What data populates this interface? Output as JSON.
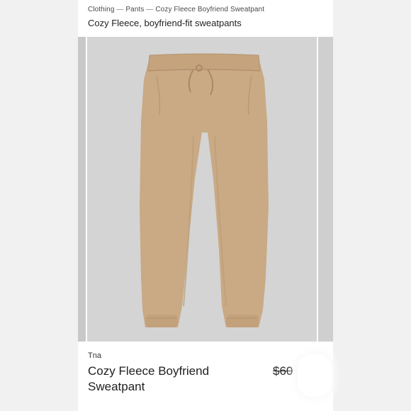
{
  "breadcrumb": {
    "items": [
      "Clothing",
      "Pants",
      "Cozy Fleece Boyfriend Sweatpant"
    ],
    "separator": "—"
  },
  "subtitle": "Cozy Fleece, boyfriend-fit sweatpants",
  "product": {
    "brand": "Tna",
    "name": "Cozy Fleece Boyfriend Sweatpant",
    "price": "$60",
    "image_icon": "sweatpants-photo",
    "colors": {
      "fabric": "#c7a883",
      "photo_background": "#d3d3d3"
    }
  }
}
